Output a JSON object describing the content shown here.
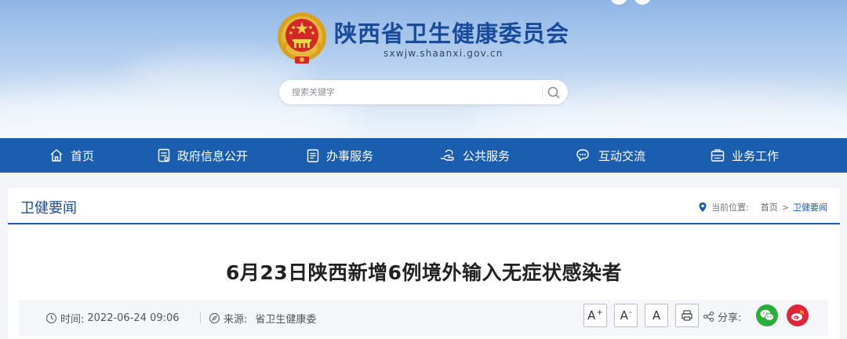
{
  "header": {
    "site_title": "陕西省卫生健康委员会",
    "site_domain": "sxwjw.shaanxi.gov.cn",
    "search_placeholder": "搜索关键字"
  },
  "nav": {
    "items": [
      {
        "label": "首页",
        "icon": "home-icon"
      },
      {
        "label": "政府信息公开",
        "icon": "document-list-icon"
      },
      {
        "label": "办事服务",
        "icon": "clipboard-icon"
      },
      {
        "label": "公共服务",
        "icon": "hand-service-icon"
      },
      {
        "label": "互动交流",
        "icon": "chat-bubbles-icon"
      },
      {
        "label": "业务工作",
        "icon": "briefcase-icon"
      }
    ]
  },
  "breadcrumb": {
    "section_title": "卫健要闻",
    "location_label": "当前位置:",
    "home": "首页",
    "separator": ">",
    "current": "卫健要闻"
  },
  "article": {
    "title": "6月23日陕西新增6例境外输入无症状感染者",
    "time_label": "时间:",
    "time_value": "2022-06-24 09:06",
    "source_label": "来源:",
    "source_value": "省卫生健康委",
    "font_large": "A",
    "font_medium": "A",
    "font_normal": "A",
    "share_label": "分享:"
  },
  "colors": {
    "nav_blue": "#1b5eb0",
    "title_blue": "#1a4a9a",
    "wechat_green": "#2aae3a",
    "weibo_red": "#e0243a"
  }
}
